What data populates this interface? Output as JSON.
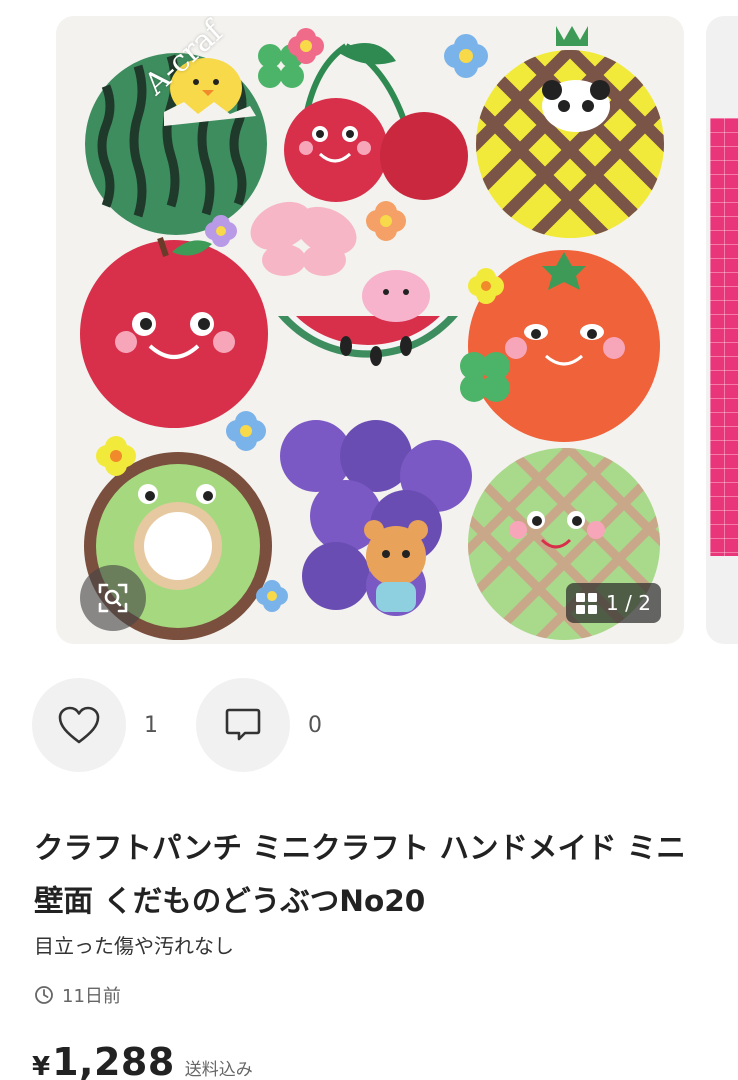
{
  "carousel": {
    "page_indicator": "1 / 2",
    "watermark_text": "A-craf",
    "zoom_icon": "zoom-scan-icon",
    "gallery_icon": "grid-icon"
  },
  "actions": {
    "like_icon": "heart-icon",
    "like_count": "1",
    "comment_icon": "comment-icon",
    "comment_count": "0"
  },
  "item": {
    "title": "クラフトパンチ ミニクラフト ハンドメイド ミニ壁面 くだものどうぶつNo20",
    "condition": "目立った傷や汚れなし",
    "posted_icon": "clock-icon",
    "posted_time": "11日前",
    "price_currency": "¥",
    "price_amount": "1,288",
    "shipping_note": "送料込み"
  },
  "colors": {
    "watermelon": "#3e8d5f",
    "apple_red": "#d8304a",
    "orange": "#f0623a",
    "grape": "#7b59c4",
    "melon": "#a9d98a",
    "pineapple_yellow": "#f2ea3a",
    "pink_accent": "#e9367a"
  }
}
